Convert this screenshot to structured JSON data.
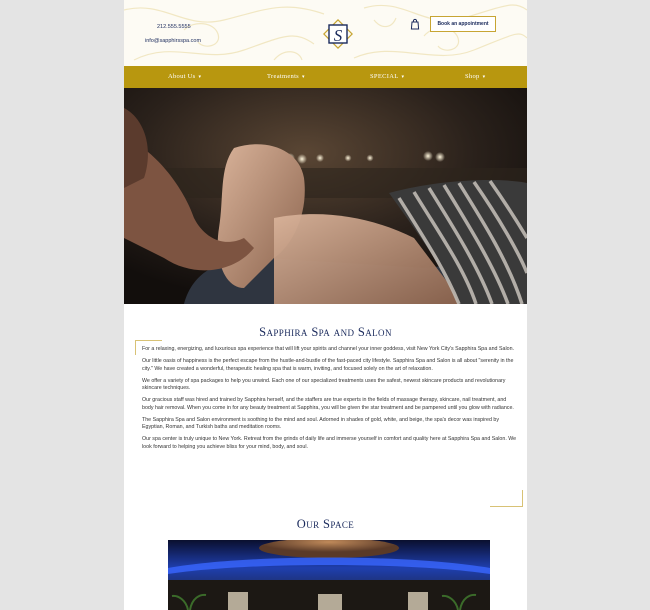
{
  "header": {
    "phone": "212.555.5555",
    "email": "info@sapphirsspa.com",
    "logo_letter": "S",
    "book_label": "Book an appointment"
  },
  "nav": {
    "items": [
      {
        "label": "About Us"
      },
      {
        "label": "Treatments"
      },
      {
        "label": "SPECIAL"
      },
      {
        "label": "Shop"
      }
    ]
  },
  "intro": {
    "title": "Sapphira Spa and Salon",
    "paragraphs": [
      "For a relaxing, energizing, and luxurious spa experience that will lift your spirits and channel your inner goddess, visit New York City's Sapphira Spa and Salon.",
      "Our little oasis of happiness is the perfect escape from the hustle-and-bustle of the fast-paced city lifestyle. Sapphira Spa and Salon is all about \"serenity in the city.\" We have created a wonderful, therapeutic healing spa that is warm, inviting, and focused solely on the art of relaxation.",
      "We offer a variety of spa packages to help you unwind. Each one of our specialized treatments uses the safest, newest skincare products and revolutionary skincare techniques.",
      "Our gracious staff was hired and trained by Sapphira herself, and the staffers are true experts in the fields of massage therapy, skincare, nail treatment, and body hair removal. When you come in for any beauty treatment at Sapphira, you will be given the star treatment and be pampered until you glow with radiance.",
      "The Sapphira Spa and Salon environment is soothing to the mind and soul. Adorned in shades of gold, white, and beige, the spa's decor was inspired by Egyptian, Roman, and Turkish baths and meditation rooms.",
      "Our spa center is truly unique to New York. Retreat from the grinds of daily life and immerse yourself in comfort and quality here at Sapphira Spa and Salon. We look forward to helping you achieve bliss for your mind, body, and soul."
    ]
  },
  "space": {
    "title": "Our Space"
  },
  "colors": {
    "gold": "#b8970f",
    "navy": "#1a2a5c"
  }
}
